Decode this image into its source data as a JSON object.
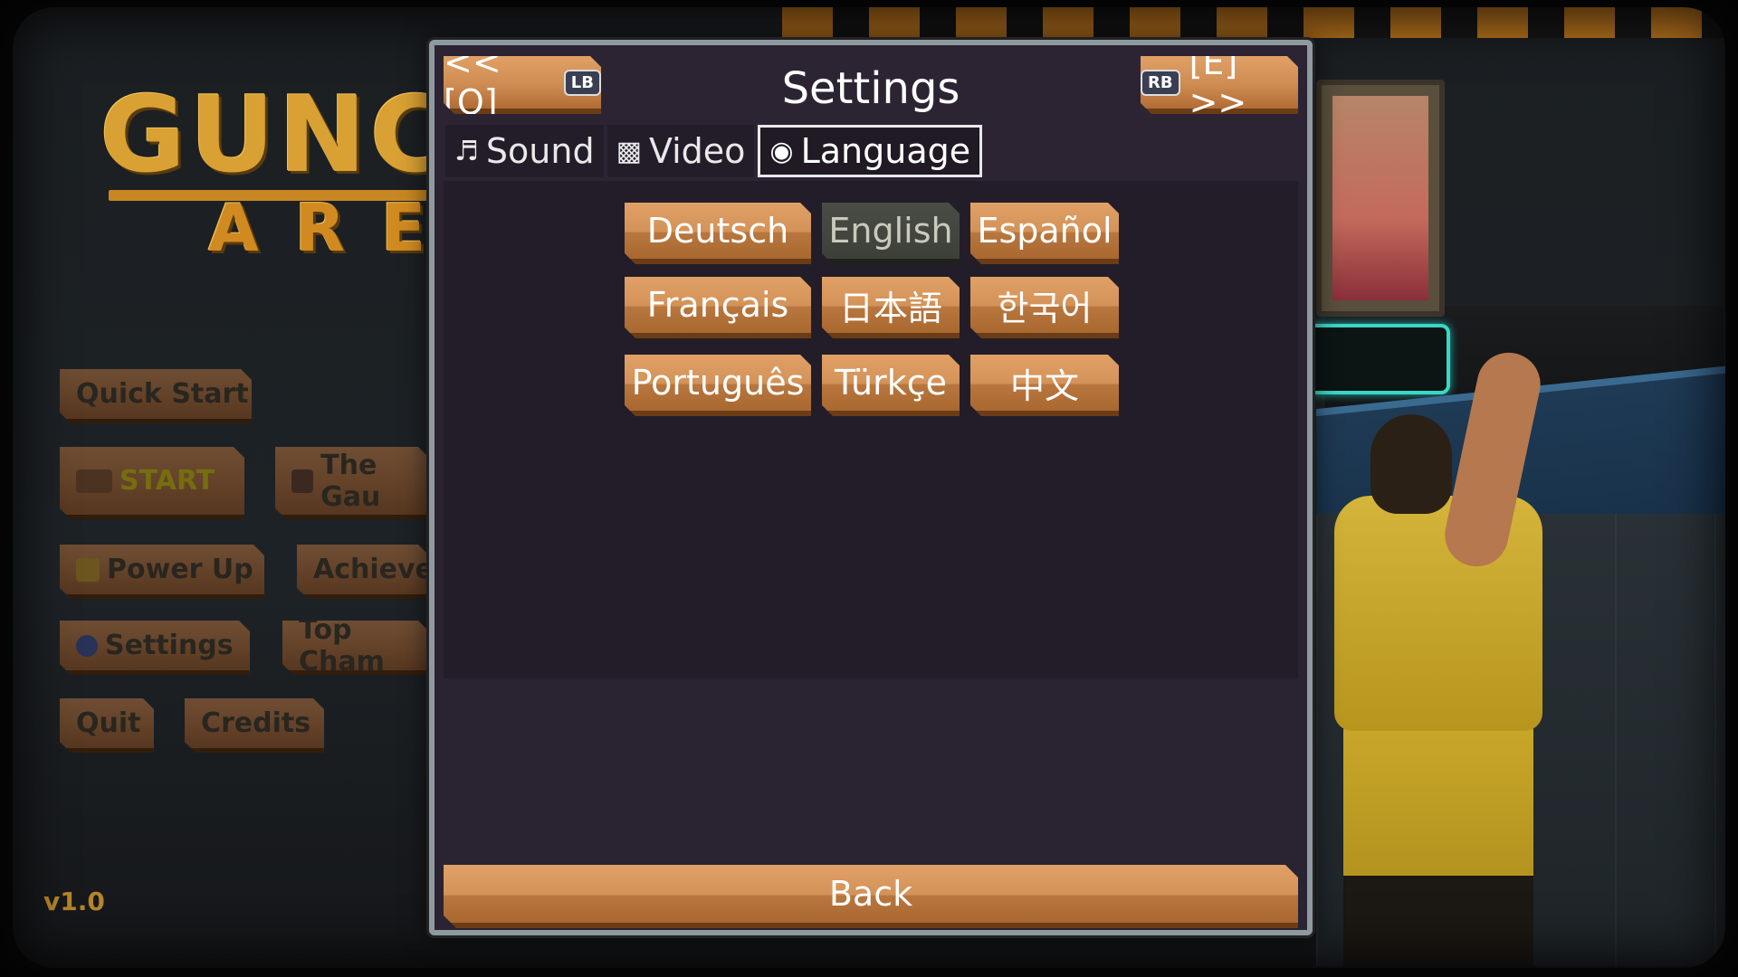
{
  "background": {
    "logo_line1": "GUNCI",
    "logo_line2": "ARE",
    "menu": {
      "quick_start": "Quick Start",
      "start": "START",
      "the_gauntlet": "The Gau",
      "power_up": "Power Up",
      "achievements": "Achieve",
      "settings": "Settings",
      "top_champions": "Top Cham",
      "quit": "Quit",
      "credits": "Credits"
    },
    "version": "v1.0"
  },
  "settings": {
    "title": "Settings",
    "prev_label": "<< [Q]",
    "prev_badge": "LB",
    "next_label": "[E] >>",
    "next_badge": "RB",
    "tabs": [
      {
        "label": "Sound",
        "icon": "music-note-icon",
        "glyph": "♬"
      },
      {
        "label": "Video",
        "icon": "checkerboard-icon",
        "glyph": "▩"
      },
      {
        "label": "Language",
        "icon": "globe-icon",
        "glyph": "◉"
      }
    ],
    "active_tab": "Language",
    "languages": [
      "Deutsch",
      "English",
      "Español",
      "Français",
      "日本語",
      "한국어",
      "Português",
      "Türkçe",
      "中文"
    ],
    "selected_language": "English",
    "back_label": "Back"
  },
  "colors": {
    "button_orange": "#d39258",
    "selected_gray": "#3d4038",
    "panel_bg": "#2a2331",
    "accent_gold": "#d9a033"
  }
}
